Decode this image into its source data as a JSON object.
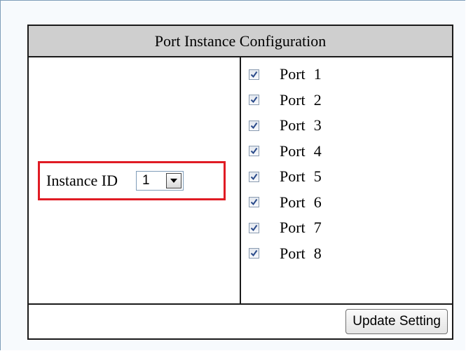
{
  "panel": {
    "title": "Port Instance Configuration"
  },
  "instance": {
    "label": "Instance ID",
    "selected_value": "1",
    "highlight_color": "#e01b24"
  },
  "ports": [
    {
      "label": "Port",
      "number": "1",
      "checked": true
    },
    {
      "label": "Port",
      "number": "2",
      "checked": true
    },
    {
      "label": "Port",
      "number": "3",
      "checked": true
    },
    {
      "label": "Port",
      "number": "4",
      "checked": true
    },
    {
      "label": "Port",
      "number": "5",
      "checked": true
    },
    {
      "label": "Port",
      "number": "6",
      "checked": true
    },
    {
      "label": "Port",
      "number": "7",
      "checked": true
    },
    {
      "label": "Port",
      "number": "8",
      "checked": true
    }
  ],
  "footer": {
    "update_button_label": "Update Setting"
  },
  "icons": {
    "dropdown": "chevron-down-icon",
    "checkmark": "checkmark-icon"
  },
  "colors": {
    "header_background": "#cfcfcf",
    "checkmark": "#2a4a8a"
  }
}
